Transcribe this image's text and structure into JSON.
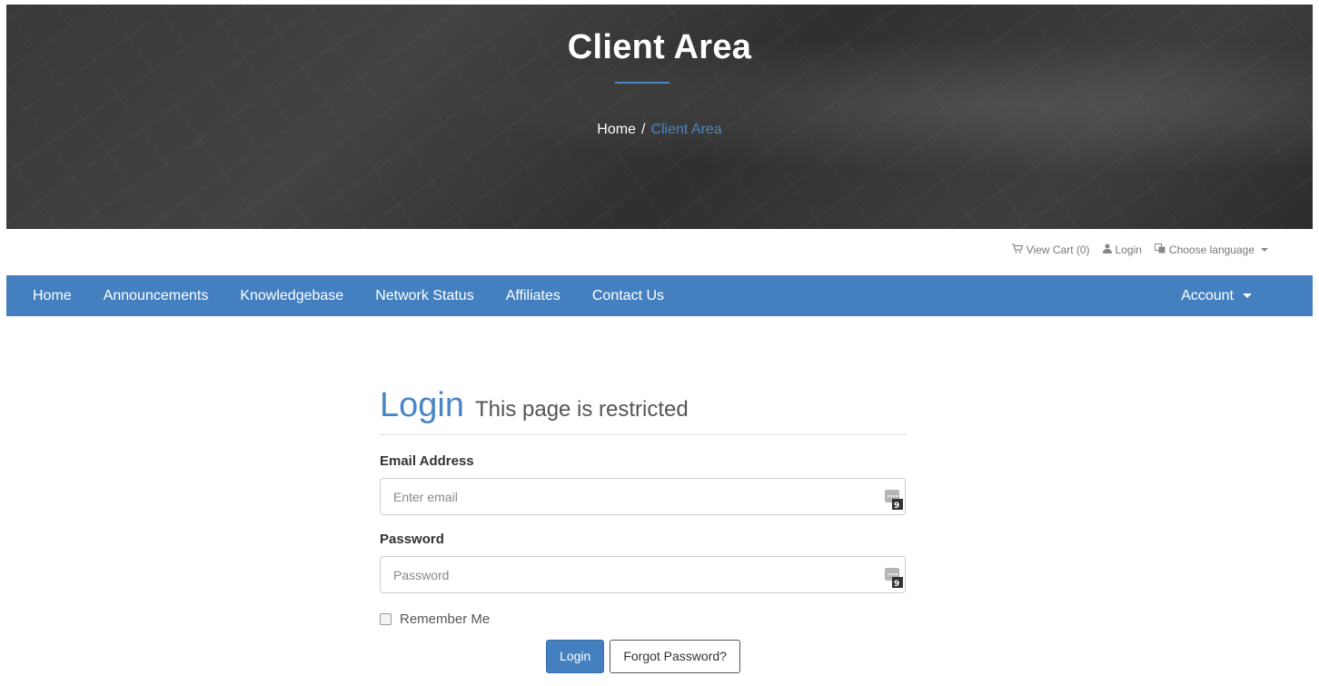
{
  "hero": {
    "title": "Client Area",
    "breadcrumb": {
      "home": "Home",
      "separator": "/",
      "current": "Client Area"
    }
  },
  "topbar": {
    "cart_label": "View Cart (0)",
    "login_label": "Login",
    "language_label": "Choose language",
    "cart_icon": "shopping-cart-icon",
    "user_icon": "user-icon",
    "language_icon": "translate-icon"
  },
  "nav": {
    "items": [
      {
        "label": "Home"
      },
      {
        "label": "Announcements"
      },
      {
        "label": "Knowledgebase"
      },
      {
        "label": "Network Status"
      },
      {
        "label": "Affiliates"
      },
      {
        "label": "Contact Us"
      }
    ],
    "account_label": "Account"
  },
  "login": {
    "title": "Login",
    "subtitle": "This page is restricted",
    "email_label": "Email Address",
    "email_placeholder": "Enter email",
    "password_label": "Password",
    "password_placeholder": "Password",
    "remember_label": "Remember Me",
    "remember_checked": false,
    "login_button": "Login",
    "forgot_button": "Forgot Password?"
  },
  "colors": {
    "accent": "#4480c0",
    "breadcrumb_current": "#4a86c5"
  }
}
